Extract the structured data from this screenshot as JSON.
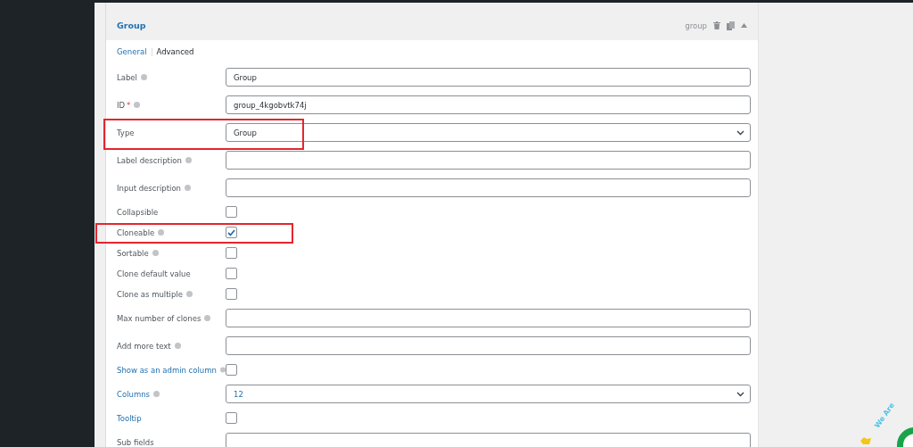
{
  "header": {
    "title": "Group",
    "field_id": "group"
  },
  "tabs": [
    {
      "label": "General",
      "selected": true
    },
    {
      "label": "Advanced",
      "selected": false
    }
  ],
  "fields": [
    {
      "kind": "text",
      "label": "Label",
      "help": true,
      "link": false,
      "highlighted": false,
      "value": "Group"
    },
    {
      "kind": "text",
      "label": "ID",
      "required_mark": "*",
      "help": true,
      "link": false,
      "highlighted": false,
      "value": "group_4kgobvtk74j"
    },
    {
      "kind": "select",
      "label": "Type",
      "help": false,
      "link": false,
      "highlighted": true,
      "value": "Group"
    },
    {
      "kind": "text",
      "label": "Label description",
      "help": true,
      "link": false,
      "highlighted": false
    },
    {
      "kind": "text",
      "label": "Input description",
      "help": true,
      "link": false,
      "highlighted": false
    },
    {
      "kind": "checkbox",
      "label": "Collapsible",
      "help": false,
      "link": false,
      "highlighted": false,
      "checked": false
    },
    {
      "kind": "checkbox",
      "label": "Cloneable",
      "help": true,
      "link": false,
      "highlighted": true,
      "checked": true
    },
    {
      "kind": "checkbox",
      "label": "Sortable",
      "help": true,
      "link": false,
      "highlighted": false,
      "checked": false
    },
    {
      "kind": "checkbox",
      "label": "Clone default value",
      "help": false,
      "link": false,
      "highlighted": false,
      "checked": false
    },
    {
      "kind": "checkbox",
      "label": "Clone as multiple",
      "help": true,
      "link": false,
      "highlighted": false,
      "checked": false
    },
    {
      "kind": "text",
      "label": "Max number of clones",
      "help": true,
      "link": false,
      "highlighted": false
    },
    {
      "kind": "text",
      "label": "Add more text",
      "help": true,
      "link": false,
      "highlighted": false
    },
    {
      "kind": "checkbox",
      "label": "Show as an admin column",
      "help": true,
      "link": true,
      "highlighted": false,
      "checked": false
    },
    {
      "kind": "select",
      "label": "Columns",
      "help": true,
      "link": true,
      "highlighted": false,
      "value": "12"
    },
    {
      "kind": "checkbox",
      "label": "Tooltip",
      "help": false,
      "link": true,
      "highlighted": false,
      "checked": false
    },
    {
      "kind": "text",
      "label": "Sub fields",
      "help": false,
      "link": false,
      "highlighted": false
    }
  ],
  "chat_widget": {
    "text": "We Are"
  }
}
